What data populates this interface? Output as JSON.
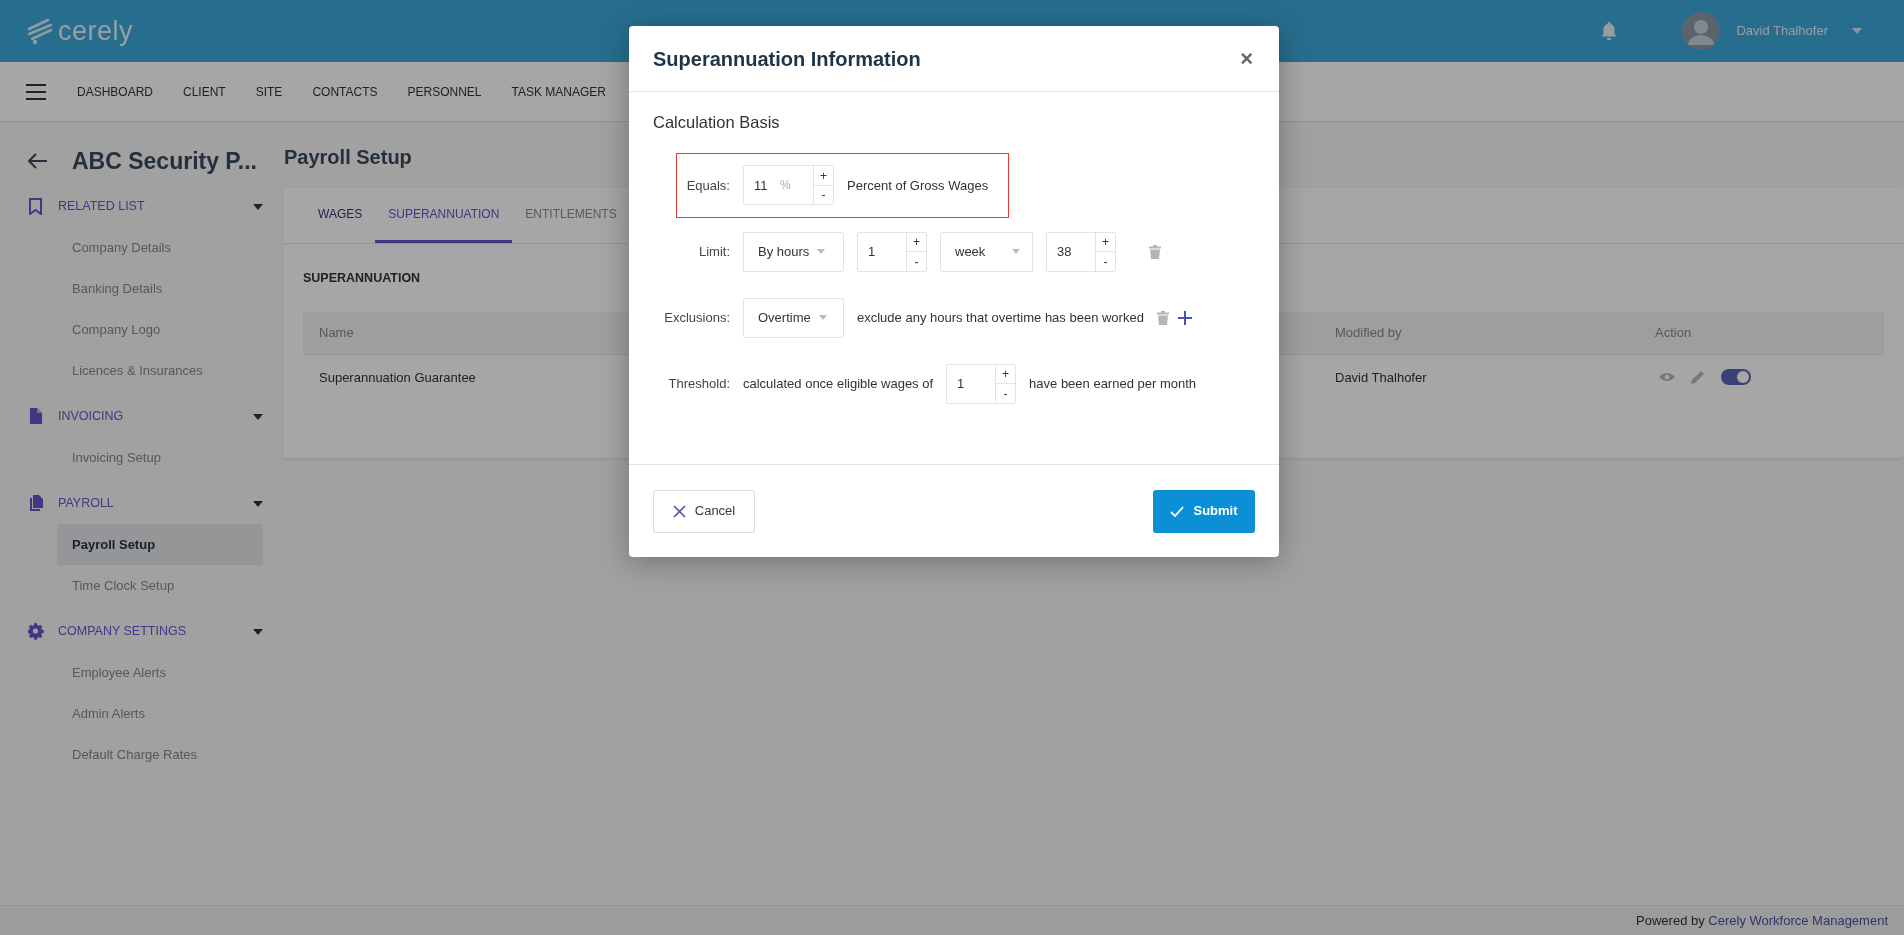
{
  "header": {
    "brand": "cerely",
    "user": "David Thalhofer"
  },
  "nav": {
    "items": [
      "DASHBOARD",
      "CLIENT",
      "SITE",
      "CONTACTS",
      "PERSONNEL",
      "TASK MANAGER"
    ]
  },
  "sidebar": {
    "title": "ABC Security P...",
    "sections": [
      {
        "label": "RELATED LIST",
        "expanded": true,
        "items": [
          {
            "label": "Company Details",
            "selected": false
          },
          {
            "label": "Banking Details",
            "selected": false
          },
          {
            "label": "Company Logo",
            "selected": false
          },
          {
            "label": "Licences & Insurances",
            "selected": false
          }
        ]
      },
      {
        "label": "INVOICING",
        "expanded": true,
        "items": [
          {
            "label": "Invoicing Setup",
            "selected": false
          }
        ]
      },
      {
        "label": "PAYROLL",
        "expanded": true,
        "items": [
          {
            "label": "Payroll Setup",
            "selected": true
          },
          {
            "label": "Time Clock Setup",
            "selected": false
          }
        ]
      },
      {
        "label": "COMPANY SETTINGS",
        "expanded": true,
        "items": [
          {
            "label": "Employee Alerts",
            "selected": false
          },
          {
            "label": "Admin Alerts",
            "selected": false
          },
          {
            "label": "Default Charge Rates",
            "selected": false
          }
        ]
      }
    ]
  },
  "page": {
    "title": "Payroll Setup",
    "tabs": [
      {
        "label": "WAGES",
        "selected": false,
        "disabled": false
      },
      {
        "label": "SUPERANNUATION",
        "selected": true,
        "disabled": false
      },
      {
        "label": "ENTITLEMENTS",
        "selected": false,
        "disabled": true
      }
    ],
    "section_title": "SUPERANNUATION",
    "table": {
      "columns": [
        "Name",
        "Modified by",
        "Action"
      ],
      "rows": [
        {
          "cells": [
            "Superannuation Guarantee",
            "David Thalhofer"
          ],
          "enabled": true
        }
      ]
    }
  },
  "modal": {
    "title": "Superannuation Information",
    "close": "×",
    "section": "Calculation Basis",
    "rows": [
      {
        "kind": "percent",
        "label": "Equals:",
        "highlighted": true,
        "field": {
          "value": "11",
          "unit": "%",
          "up": "+",
          "down": "-"
        },
        "text": "Percent of Gross Wages"
      },
      {
        "kind": "limit",
        "label": "Limit:",
        "highlighted": false,
        "basis": "By hours",
        "count": {
          "value": "1",
          "up": "+",
          "down": "-"
        },
        "period": "week",
        "hours": {
          "value": "38",
          "up": "+",
          "down": "-"
        }
      },
      {
        "kind": "exclusion",
        "label": "Exclusions:",
        "highlighted": false,
        "type": "Overtime",
        "text": "exclude any hours that overtime has been worked"
      },
      {
        "kind": "threshold",
        "label": "Threshold:",
        "highlighted": false,
        "text_before": "calculated once eligible wages of",
        "field": {
          "value": "1",
          "up": "+",
          "down": "-"
        },
        "text_after": "have been earned per month"
      }
    ],
    "buttons": {
      "cancel": "Cancel",
      "submit": "Submit"
    }
  },
  "footer": {
    "text": "Powered by",
    "link": "Cerely Workforce Management"
  }
}
